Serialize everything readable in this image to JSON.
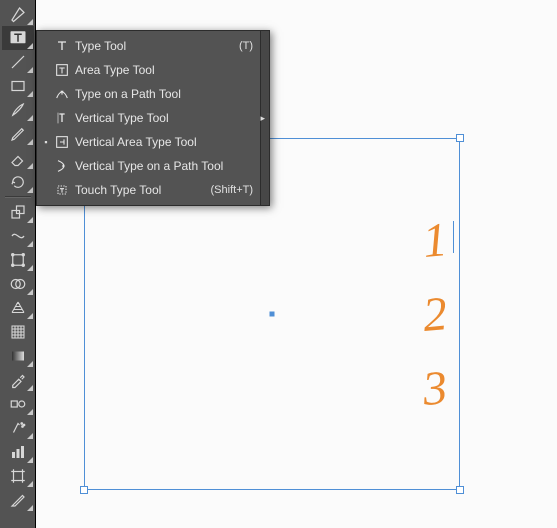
{
  "toolbar": {
    "tools": [
      "pen-tool",
      "type-tool",
      "line-segment-tool",
      "rectangle-tool",
      "paintbrush-tool",
      "pencil-tool",
      "eraser-tool",
      "rotate-tool",
      "scale-tool",
      "width-tool",
      "free-transform-tool",
      "shape-builder-tool",
      "perspective-grid-tool",
      "mesh-tool",
      "gradient-tool",
      "eyedropper-tool",
      "blend-tool",
      "symbol-sprayer-tool",
      "column-graph-tool",
      "artboard-tool",
      "slice-tool"
    ]
  },
  "flyout": {
    "items": [
      {
        "label": "Type Tool",
        "shortcut": "(T)",
        "selected": false
      },
      {
        "label": "Area Type Tool",
        "shortcut": "",
        "selected": false
      },
      {
        "label": "Type on a Path Tool",
        "shortcut": "",
        "selected": false
      },
      {
        "label": "Vertical Type Tool",
        "shortcut": "",
        "selected": false,
        "submenu": true
      },
      {
        "label": "Vertical Area Type Tool",
        "shortcut": "",
        "selected": true
      },
      {
        "label": "Vertical Type on a Path Tool",
        "shortcut": "",
        "selected": false
      },
      {
        "label": "Touch Type Tool",
        "shortcut": "(Shift+T)",
        "selected": false
      }
    ]
  },
  "canvas": {
    "text": [
      "1",
      "2",
      "3"
    ]
  }
}
